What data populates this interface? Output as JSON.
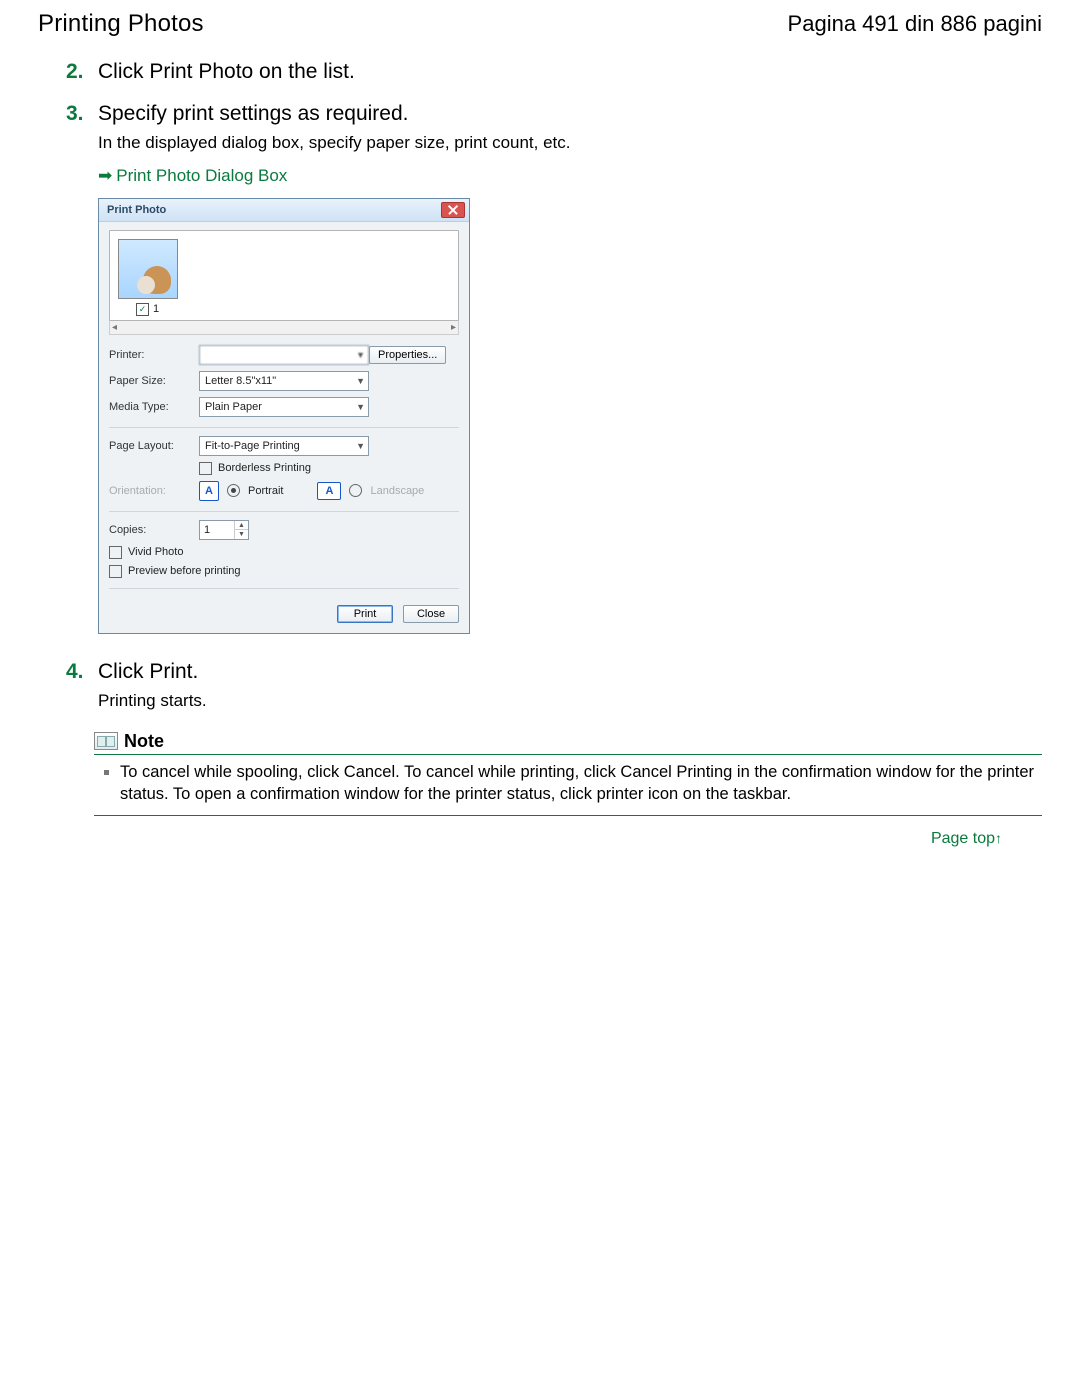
{
  "header": {
    "title": "Printing Photos",
    "page_counter": "Pagina 491 din 886 pagini"
  },
  "steps": {
    "s2": {
      "num": "2.",
      "title": "Click Print Photo on the list."
    },
    "s3": {
      "num": "3.",
      "title": "Specify print settings as required.",
      "desc": "In the displayed dialog box, specify paper size, print count, etc.",
      "link": "Print Photo Dialog Box"
    },
    "s4": {
      "num": "4.",
      "title": "Click Print.",
      "desc": "Printing starts."
    }
  },
  "dialog": {
    "title": "Print Photo",
    "thumb_index": "1",
    "labels": {
      "printer": "Printer:",
      "paper_size": "Paper Size:",
      "media_type": "Media Type:",
      "page_layout": "Page Layout:",
      "borderless": "Borderless Printing",
      "orientation": "Orientation:",
      "portrait": "Portrait",
      "landscape": "Landscape",
      "copies": "Copies:",
      "vivid": "Vivid Photo",
      "preview": "Preview before printing"
    },
    "values": {
      "printer": " ",
      "paper_size": "Letter 8.5\"x11\"",
      "media_type": "Plain Paper",
      "page_layout": "Fit-to-Page Printing",
      "copies": "1"
    },
    "buttons": {
      "properties": "Properties...",
      "print": "Print",
      "close": "Close"
    }
  },
  "note": {
    "title": "Note",
    "text": "To cancel while spooling, click Cancel. To cancel while printing, click Cancel Printing in the confirmation window for the printer status. To open a confirmation window for the printer status, click printer icon on the taskbar."
  },
  "page_top": "Page top"
}
